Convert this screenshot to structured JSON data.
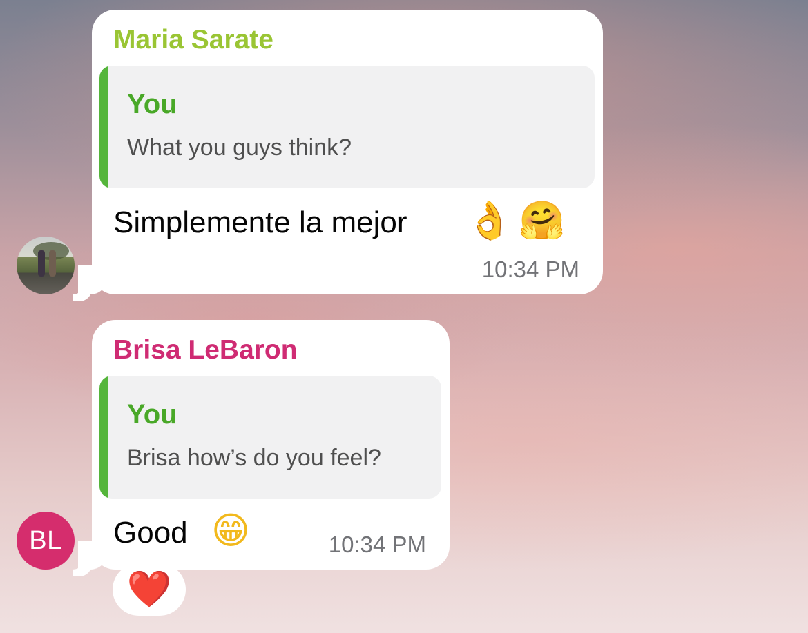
{
  "messages": [
    {
      "sender": "Maria Sarate",
      "sender_color": "#9ac534",
      "avatar": "photo-avatar",
      "reply_author": "You",
      "reply_text": "What you guys think?",
      "text": "Simplemente la mejor",
      "emojis": [
        "👌",
        "🤗"
      ],
      "time": "10:34 PM"
    },
    {
      "sender": "Brisa LeBaron",
      "sender_color": "#cf2b73",
      "avatar_initials": "BL",
      "avatar_color": "#d52d6d",
      "reply_author": "You",
      "reply_text": "Brisa how’s do you feel?",
      "text": "Good",
      "emojis": [
        "😁"
      ],
      "time": "10:34 PM",
      "reaction": "❤️"
    }
  ]
}
